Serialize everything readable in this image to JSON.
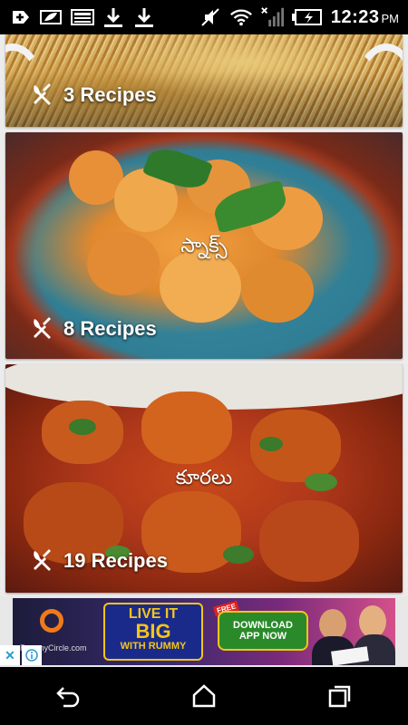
{
  "status_bar": {
    "time": "12:23",
    "ampm": "PM",
    "icons": [
      "add-icon",
      "battery-saver-icon",
      "image-icon",
      "download-icon",
      "download-icon",
      "mute-icon",
      "wifi-icon",
      "signal-icon",
      "battery-charging-icon"
    ]
  },
  "categories": [
    {
      "title": "",
      "count_label": "3 Recipes"
    },
    {
      "title": "స్నాక్స్",
      "count_label": "8 Recipes"
    },
    {
      "title": "కూరలు",
      "count_label": "19 Recipes"
    }
  ],
  "ad": {
    "brand": "RummyCircle.com",
    "headline_1": "LIVE IT",
    "headline_2": "BIG",
    "headline_3": "WITH RUMMY",
    "badge": "FREE",
    "cta_1": "DOWNLOAD",
    "cta_2": "APP NOW",
    "close_glyph": "✕"
  },
  "colors": {
    "accent_orange": "#f07a1a",
    "ad_gold": "#f5c518",
    "ad_cta_green": "#2a8a2a"
  }
}
